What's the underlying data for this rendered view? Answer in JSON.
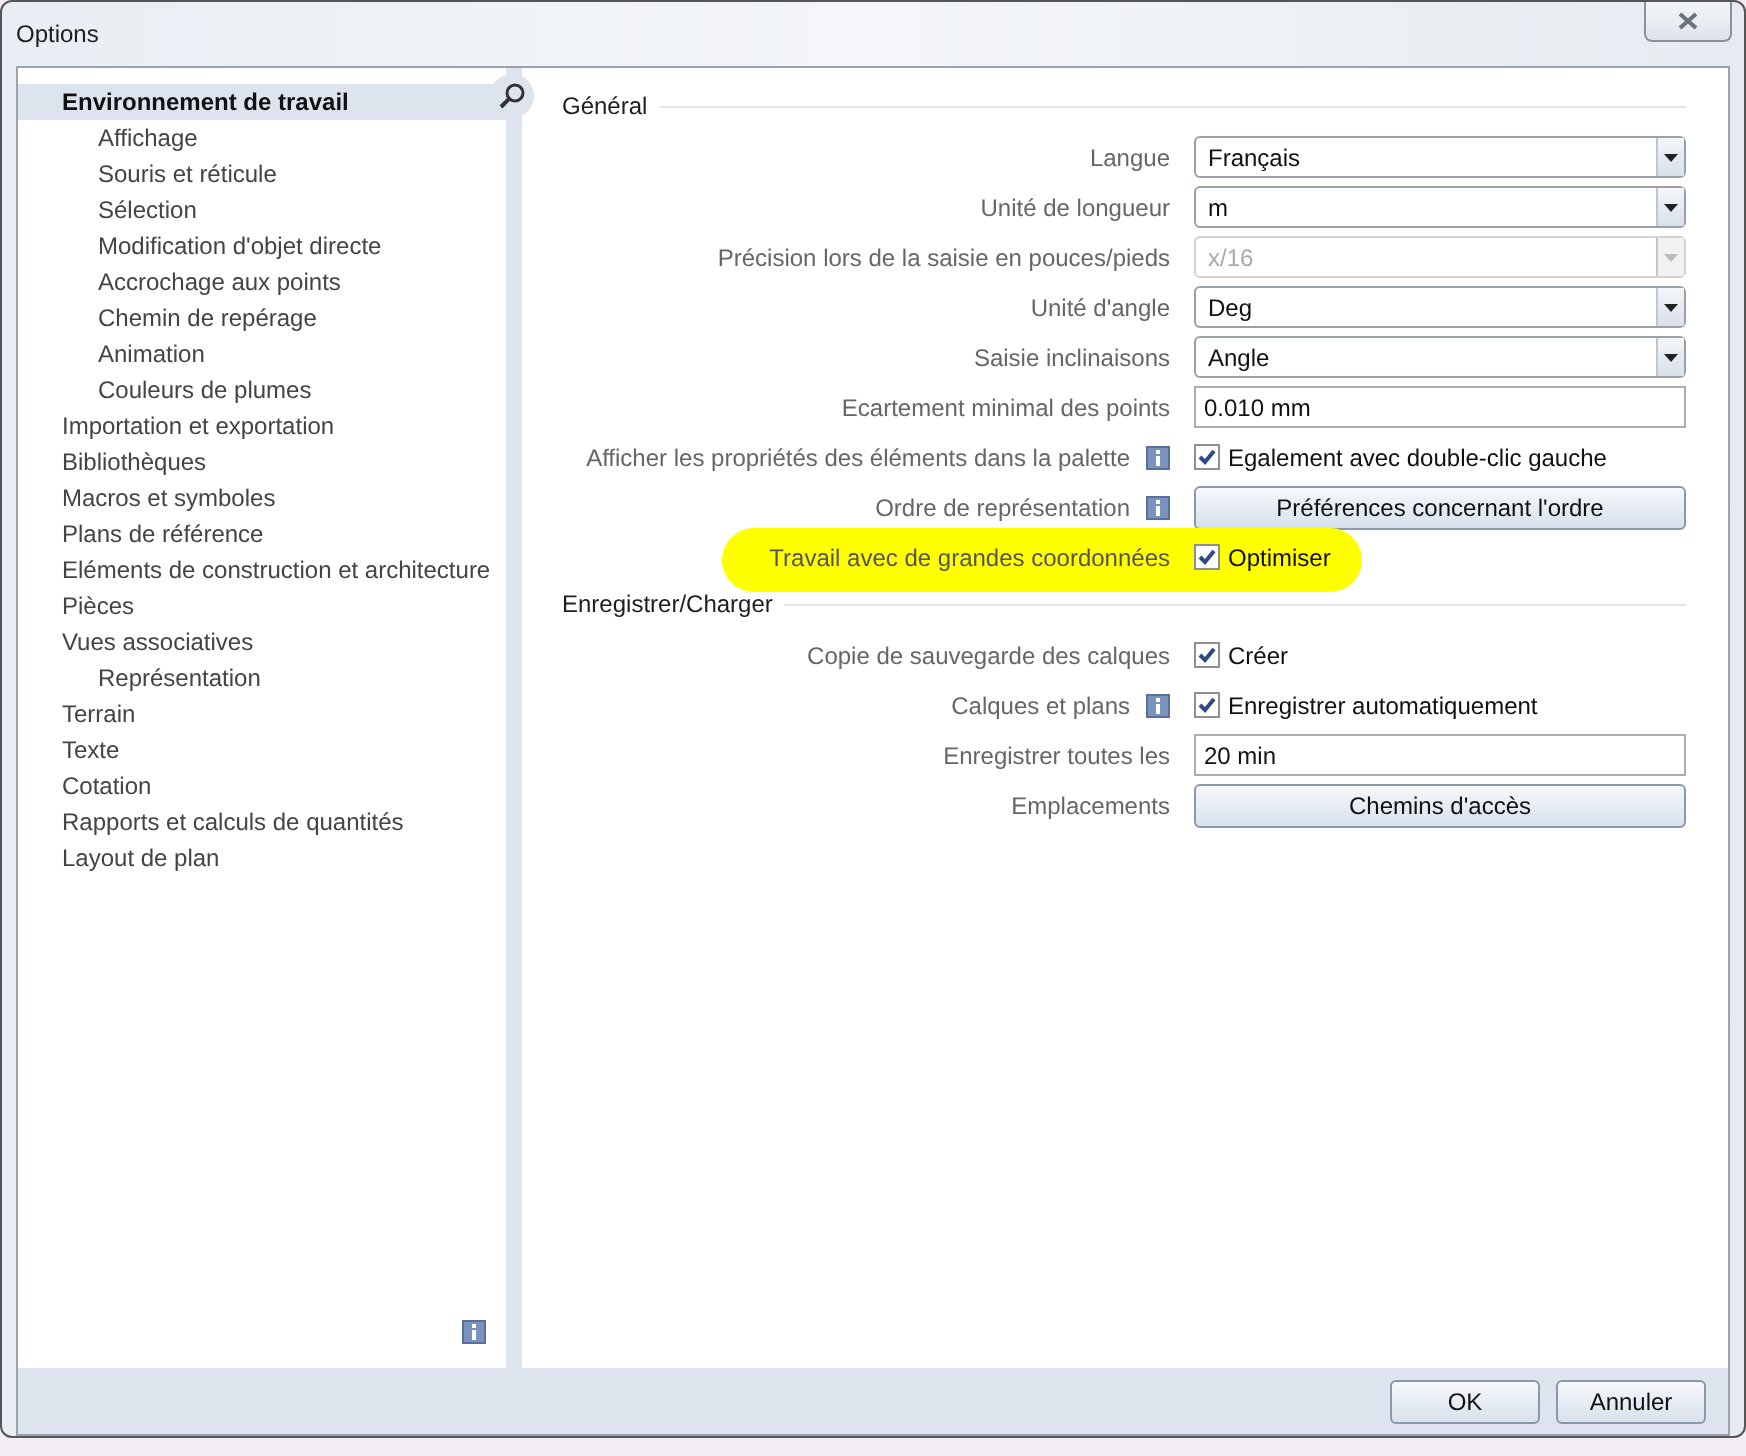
{
  "window": {
    "title": "Options"
  },
  "sidebar": {
    "items": [
      {
        "label": "Environnement de travail",
        "selected": true,
        "children": [
          {
            "label": "Affichage",
            "selected": false
          },
          {
            "label": "Souris et réticule",
            "selected": false
          },
          {
            "label": "Sélection",
            "selected": false
          },
          {
            "label": "Modification d'objet directe",
            "selected": false
          },
          {
            "label": "Accrochage aux points",
            "selected": false
          },
          {
            "label": "Chemin de repérage",
            "selected": false
          },
          {
            "label": "Animation",
            "selected": false
          },
          {
            "label": "Couleurs de plumes",
            "selected": false
          }
        ]
      },
      {
        "label": "Importation et exportation",
        "selected": false
      },
      {
        "label": "Bibliothèques",
        "selected": false
      },
      {
        "label": "Macros et symboles",
        "selected": false
      },
      {
        "label": "Plans de référence",
        "selected": false
      },
      {
        "label": "Eléments de construction et architecture",
        "selected": false
      },
      {
        "label": "Pièces",
        "selected": false
      },
      {
        "label": "Vues associatives",
        "selected": false,
        "children": [
          {
            "label": "Représentation",
            "selected": false
          }
        ]
      },
      {
        "label": "Terrain",
        "selected": false
      },
      {
        "label": "Texte",
        "selected": false
      },
      {
        "label": "Cotation",
        "selected": false
      },
      {
        "label": "Rapports et calculs de quantités",
        "selected": false
      },
      {
        "label": "Layout de plan",
        "selected": false
      }
    ]
  },
  "sections": [
    {
      "title": "Général",
      "rows": [
        {
          "label": "Langue",
          "kind": "dropdown",
          "value": "Français",
          "disabled": false
        },
        {
          "label": "Unité de longueur",
          "kind": "dropdown",
          "value": "m",
          "disabled": false
        },
        {
          "label": "Précision lors de la saisie en pouces/pieds",
          "kind": "dropdown",
          "value": "x/16",
          "disabled": true
        },
        {
          "label": "Unité d'angle",
          "kind": "dropdown",
          "value": "Deg",
          "disabled": false
        },
        {
          "label": "Saisie inclinaisons",
          "kind": "dropdown",
          "value": "Angle",
          "disabled": false
        },
        {
          "label": "Ecartement minimal des points",
          "kind": "text",
          "value": "0.010 mm"
        },
        {
          "label": "Afficher les propriétés des éléments dans la palette",
          "kind": "checkbox",
          "info": true,
          "checked": true,
          "text": "Egalement avec double-clic gauche"
        },
        {
          "label": "Ordre de représentation",
          "kind": "button",
          "info": true,
          "text": "Préférences concernant l'ordre"
        },
        {
          "label": "Travail avec de grandes coordonnées",
          "kind": "checkbox",
          "checked": true,
          "text": "Optimiser",
          "highlighted": true
        }
      ]
    },
    {
      "title": "Enregistrer/Charger",
      "rows": [
        {
          "label": "Copie de sauvegarde des calques",
          "kind": "checkbox",
          "checked": true,
          "text": "Créer"
        },
        {
          "label": "Calques et plans",
          "kind": "checkbox",
          "info": true,
          "checked": true,
          "text": "Enregistrer automatiquement"
        },
        {
          "label": "Enregistrer toutes les",
          "kind": "text",
          "value": "20 min"
        },
        {
          "label": "Emplacements",
          "kind": "button",
          "text": "Chemins d'accès"
        }
      ]
    }
  ],
  "buttons": [
    "OK",
    "Annuler"
  ]
}
